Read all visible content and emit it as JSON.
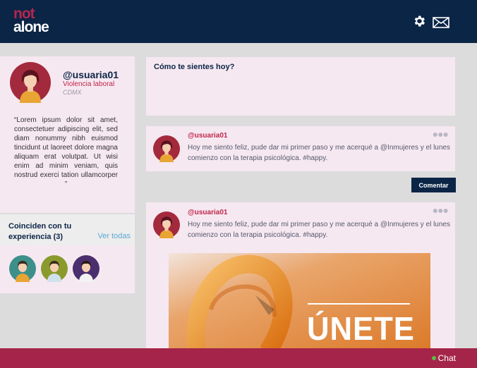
{
  "header": {
    "logo_line1": "not",
    "logo_line2": "alone",
    "settings_icon": "gear-icon",
    "messages_icon": "envelope-icon"
  },
  "profile": {
    "username": "@usuaria01",
    "category": "Violencia laboral",
    "location": "CDMX",
    "quote": "“Lorem ipsum dolor sit amet, consectetuer adipiscing elit, sed diam nonummy nibh euismod tincidunt ut laoreet dolore magna aliquam erat volutpat. Ut wisi enim ad minim veniam, quis nostrud exerci tation ullamcorper ”"
  },
  "matches": {
    "title": "Coinciden con tu experiencia (3)",
    "see_all": "Ver todas"
  },
  "composer": {
    "placeholder": "Cómo te sientes hoy?"
  },
  "posts": [
    {
      "user": "@usuaria01",
      "text": "Hoy me siento feliz, pude dar mi primer paso y me acerqué a @Inmujeres y el lunes comienzo con la terapia psicológica. #happy.",
      "menu_icon": "ellipsis-icon"
    },
    {
      "user": "@usuaria01",
      "text": "Hoy me siento feliz, pude dar mi primer paso y me acerqué a @Inmujeres y el lunes comienzo con la terapia psicológica. #happy.",
      "menu_icon": "ellipsis-icon",
      "image_text": "ÚNETE"
    }
  ],
  "comment_button": "Comentar",
  "footer": {
    "chat_label": "Chat",
    "status": "online"
  },
  "colors": {
    "navy": "#0b2546",
    "brand_pink": "#b52550",
    "card_bg": "#f6e8f1",
    "footer": "#a42549",
    "orange": "#e8892e"
  }
}
